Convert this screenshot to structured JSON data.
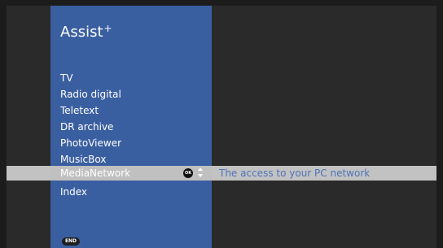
{
  "menu": {
    "title": "Assist",
    "title_sup": "+",
    "items": [
      {
        "label": "TV"
      },
      {
        "label": "Radio digital"
      },
      {
        "label": "Teletext"
      },
      {
        "label": "DR archive"
      },
      {
        "label": "PhotoViewer"
      },
      {
        "label": "MusicBox"
      },
      {
        "label": "MediaNetwork"
      },
      {
        "label": "Index"
      }
    ],
    "selected_index": 6,
    "selected_label": "MediaNetwork",
    "selected_description": "The access to your PC network"
  },
  "controls": {
    "ok_icon": "OK",
    "updown_icon": "up-down-arrows-icon",
    "end_label": "END"
  },
  "colors": {
    "panel": "#3a5fa0",
    "highlight": "#c2c2c2",
    "description_text": "#4f74b9",
    "background": "#2a2a2a"
  }
}
